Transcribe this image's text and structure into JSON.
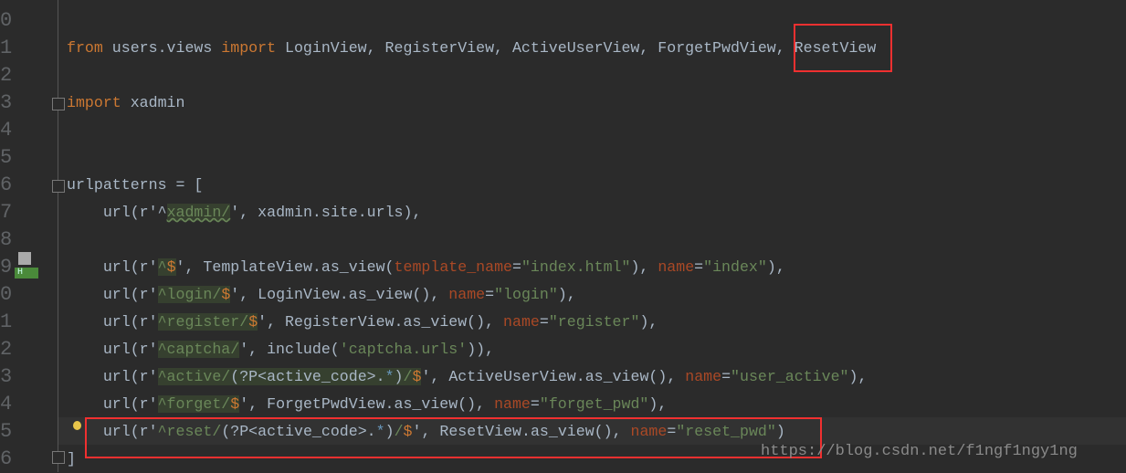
{
  "line_numbers": [
    "0",
    "1",
    "2",
    "3",
    "4",
    "5",
    "6",
    "7",
    "8",
    "9",
    "0",
    "1",
    "2",
    "3",
    "4",
    "5",
    "6"
  ],
  "current_line_index": 15,
  "gutter_badge": "H",
  "icons": [
    "bookmark-icon",
    "lightbulb-icon",
    "fold-icon"
  ],
  "highlight_color": "#f03030",
  "code_lines": [
    [],
    [
      [
        "from ",
        "kw"
      ],
      [
        "users.views ",
        ""
      ],
      [
        "import ",
        "kw"
      ],
      [
        "LoginView, RegisterView, ActiveUserView, ForgetPwdView, ResetView",
        ""
      ]
    ],
    [],
    [
      [
        "import ",
        "kw"
      ],
      [
        "xadmin",
        ""
      ]
    ],
    [],
    [],
    [
      [
        "urlpatterns = [",
        ""
      ]
    ],
    [
      [
        "    url(r'",
        ""
      ],
      [
        "^",
        ""
      ],
      [
        "xadmin/",
        "rx wavy"
      ],
      [
        "', xadmin.site.urls),",
        ""
      ]
    ],
    [],
    [
      [
        "    url(r'",
        ""
      ],
      [
        "^",
        "rx"
      ],
      [
        "$",
        "rxs"
      ],
      [
        "', TemplateView.as_view(",
        ""
      ],
      [
        "template_name",
        "kwarg"
      ],
      [
        "=",
        ""
      ],
      [
        "\"index.html\"",
        "str"
      ],
      [
        "), ",
        ""
      ],
      [
        "name",
        "kwarg"
      ],
      [
        "=",
        ""
      ],
      [
        "\"index\"",
        "str"
      ],
      [
        "),",
        ""
      ]
    ],
    [
      [
        "    url(r'",
        ""
      ],
      [
        "^login/",
        "rx"
      ],
      [
        "$",
        "rxs"
      ],
      [
        "', LoginView.as_view(), ",
        ""
      ],
      [
        "name",
        "kwarg"
      ],
      [
        "=",
        ""
      ],
      [
        "\"login\"",
        "str"
      ],
      [
        "),",
        ""
      ]
    ],
    [
      [
        "    url(r'",
        ""
      ],
      [
        "^register/",
        "rx"
      ],
      [
        "$",
        "rxs"
      ],
      [
        "', RegisterView.as_view(), ",
        ""
      ],
      [
        "name",
        "kwarg"
      ],
      [
        "=",
        ""
      ],
      [
        "\"register\"",
        "str"
      ],
      [
        "),",
        ""
      ]
    ],
    [
      [
        "    url(r'",
        ""
      ],
      [
        "^captcha/",
        "rx"
      ],
      [
        "', include(",
        ""
      ],
      [
        "'captcha.urls'",
        "str"
      ],
      [
        ")),",
        ""
      ]
    ],
    [
      [
        "    url(r'",
        ""
      ],
      [
        "^active/",
        "rx"
      ],
      [
        "(?P<",
        "rxg"
      ],
      [
        "active_code",
        "rxg"
      ],
      [
        ">.",
        "rxg"
      ],
      [
        "*",
        "rxb"
      ],
      [
        ")",
        "rxg"
      ],
      [
        "/",
        "rx"
      ],
      [
        "$",
        "rxs"
      ],
      [
        "', ActiveUserView.as_view(), ",
        ""
      ],
      [
        "name",
        "kwarg"
      ],
      [
        "=",
        ""
      ],
      [
        "\"user_active\"",
        "str"
      ],
      [
        "),",
        ""
      ]
    ],
    [
      [
        "    url(r'",
        ""
      ],
      [
        "^forget/",
        "rx"
      ],
      [
        "$",
        "rxs"
      ],
      [
        "', ForgetPwdView.as_view(), ",
        ""
      ],
      [
        "name",
        "kwarg"
      ],
      [
        "=",
        ""
      ],
      [
        "\"forget_pwd\"",
        "str"
      ],
      [
        "),",
        ""
      ]
    ],
    [
      [
        "    url(r'",
        ""
      ],
      [
        "^reset/",
        "rxn"
      ],
      [
        "(?P<",
        "rxgn"
      ],
      [
        "active_code",
        "rxgn"
      ],
      [
        ">.",
        "rxgn"
      ],
      [
        "*",
        "rxbn"
      ],
      [
        ")",
        "rxgn"
      ],
      [
        "/",
        "rxn"
      ],
      [
        "$",
        "rxsn"
      ],
      [
        "', ResetView.as_view(), ",
        ""
      ],
      [
        "name",
        "kwarg"
      ],
      [
        "=",
        ""
      ],
      [
        "\"reset_pwd\"",
        "str"
      ],
      [
        ")",
        ""
      ]
    ],
    [
      [
        "]",
        ""
      ]
    ]
  ],
  "watermark": "https://blog.csdn.net/f1ngf1ngy1ng"
}
